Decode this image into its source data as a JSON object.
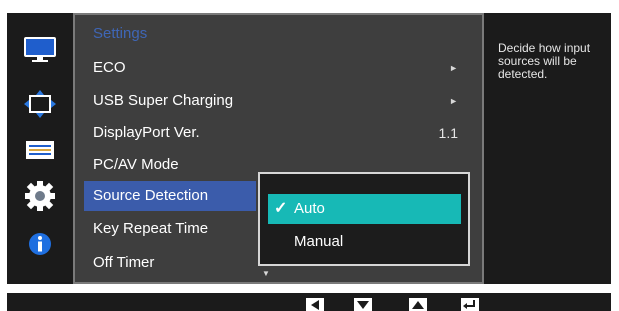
{
  "menu": {
    "title": "Settings",
    "items": [
      {
        "label": "ECO",
        "arrow": "►",
        "value": ""
      },
      {
        "label": "USB Super Charging",
        "arrow": "►",
        "value": ""
      },
      {
        "label": "DisplayPort Ver.",
        "arrow": "",
        "value": "1.1"
      },
      {
        "label": "PC/AV Mode",
        "arrow": "",
        "value": ""
      },
      {
        "label": "Source Detection",
        "arrow": "",
        "value": ""
      },
      {
        "label": "Key Repeat Time",
        "arrow": "",
        "value": ""
      },
      {
        "label": "Off Timer",
        "arrow": "",
        "value": ""
      }
    ],
    "more_indicator": "▼"
  },
  "submenu": {
    "options": [
      {
        "label": "Auto",
        "check": "✓"
      },
      {
        "label": "Manual",
        "check": ""
      }
    ]
  },
  "help": {
    "text": "Decide how input sources will be detected."
  },
  "icons": [
    "picture-icon",
    "position-icon",
    "settings-sliders-icon",
    "gear-icon",
    "info-icon"
  ],
  "colors": {
    "highlight": "#3b5cab",
    "submenu_selected": "#17b9b6",
    "title": "#3f66b6"
  }
}
